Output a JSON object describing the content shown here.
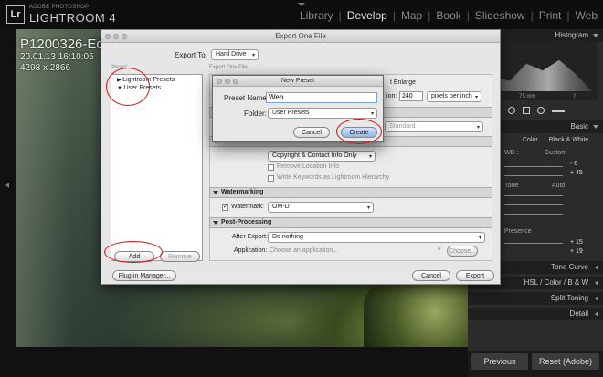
{
  "app": {
    "vendor": "ADOBE PHOTOSHOP",
    "name": "LIGHTROOM 4",
    "logo": "Lr"
  },
  "modules": [
    "Library",
    "Develop",
    "Map",
    "Book",
    "Slideshow",
    "Print",
    "Web"
  ],
  "active_module": "Develop",
  "photo_info": {
    "filename": "P1200326-Ed",
    "datetime": "20.01.13 16:10:05",
    "dimensions": "4298 x 2866"
  },
  "right_panel": {
    "histogram_title": "Histogram",
    "histogram_labels": [
      "75 mm",
      "f"
    ],
    "basic_title": "Basic",
    "treatment": [
      "Color",
      "Black & White"
    ],
    "wb_label": "WB :",
    "wb_value": "Custom",
    "tone_label": "Tone",
    "tone_auto": "Auto",
    "presence_label": "Presence",
    "values": [
      "- 6",
      "+ 45",
      "+ 15",
      "+ 19"
    ],
    "tone_curve": "Tone Curve",
    "hsl": "HSL / Color / B & W",
    "split_toning": "Split Toning",
    "detail": "Detail",
    "previous_label": "Previous",
    "reset_label": "Reset (Adobe)"
  },
  "export_dialog": {
    "title": "Export One File",
    "export_to_label": "Export To:",
    "export_to_value": "Hard Drive",
    "preset_heading": "Preset:",
    "settings_heading": "Export One File",
    "presets": [
      "Lightroom Presets",
      "User Presets"
    ],
    "enlarge_text": "t Enlarge",
    "resolution_label": "ion:",
    "resolution_value": "240",
    "resolution_unit": "pixels per inch",
    "standard_value": "Standard",
    "metadata_value": "Copyright & Contact Info Only",
    "remove_location": "Remove Location Info",
    "write_keywords": "Write Keywords as Lightroom Hierarchy",
    "watermarking_title": "Watermarking",
    "watermark_label": "Watermark:",
    "watermark_value": "OM-D",
    "postprocessing_title": "Post-Processing",
    "after_export_label": "After Export:",
    "after_export_value": "Do nothing",
    "application_label": "Application:",
    "application_placeholder": "Choose an application...",
    "choose_label": "Choose...",
    "add_label": "Add",
    "remove_label": "Remove",
    "plugin_label": "Plug-in Manager...",
    "cancel_label": "Cancel",
    "export_label": "Export"
  },
  "new_preset": {
    "title": "New Preset",
    "name_label": "Preset Name:",
    "name_value": "Web",
    "folder_label": "Folder:",
    "folder_value": "User Presets",
    "cancel_label": "Cancel",
    "create_label": "Create"
  },
  "colors": {
    "annotation": "#d01818",
    "create_button": "#a9c7ef"
  }
}
